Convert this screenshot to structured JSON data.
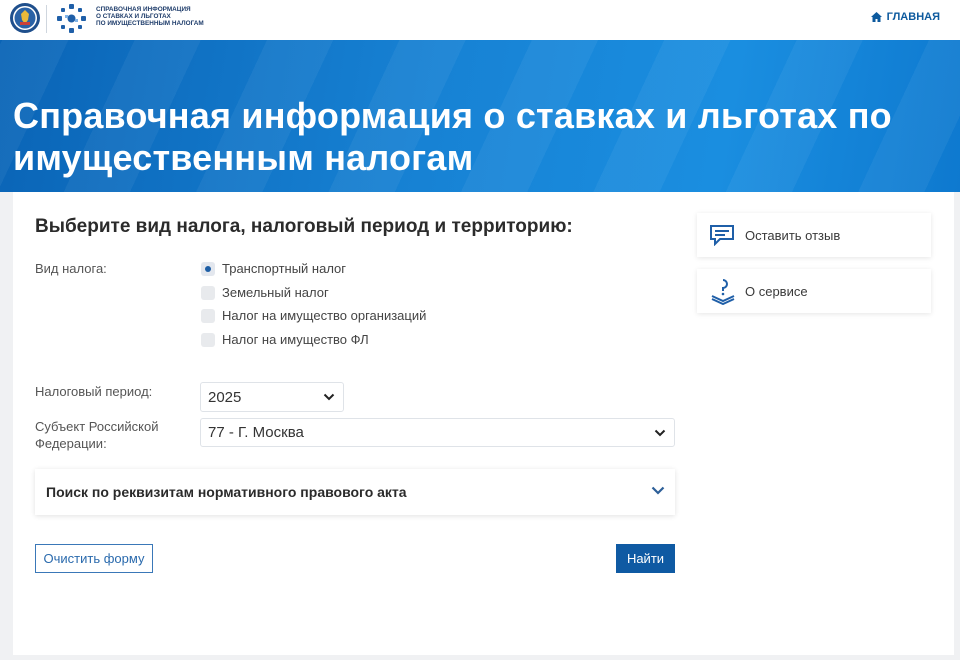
{
  "header": {
    "logo_text_lines": [
      "СПРАВОЧНАЯ ИНФОРМАЦИЯ",
      "О СТАВКАХ И ЛЬГОТАХ",
      "ПО ИМУЩЕСТВЕННЫМ НАЛОГАМ"
    ],
    "home_label": "ГЛАВНАЯ"
  },
  "hero": {
    "title": "Справочная информация о ставках и льготах по имущественным налогам"
  },
  "form": {
    "section_title": "Выберите вид налога, налоговый период и территорию:",
    "tax_type_label": "Вид налога:",
    "tax_types": [
      {
        "label": "Транспортный налог",
        "checked": true
      },
      {
        "label": "Земельный налог",
        "checked": false
      },
      {
        "label": "Налог на имущество организаций",
        "checked": false
      },
      {
        "label": "Налог на имущество ФЛ",
        "checked": false
      }
    ],
    "period_label": "Налоговый период:",
    "period_value": "2025",
    "region_label_line1": "Субъект Российской",
    "region_label_line2": "Федерации:",
    "region_value": "77 - Г. Москва",
    "accordion_label": "Поиск по реквизитам нормативного правового акта",
    "clear_button": "Очистить форму",
    "find_button": "Найти"
  },
  "sidebar": {
    "feedback_label": "Оставить отзыв",
    "about_label": "О сервисе"
  },
  "colors": {
    "accent": "#0f5aa3",
    "hero_blue": "#1782d4",
    "link": "#0d5a9e"
  }
}
